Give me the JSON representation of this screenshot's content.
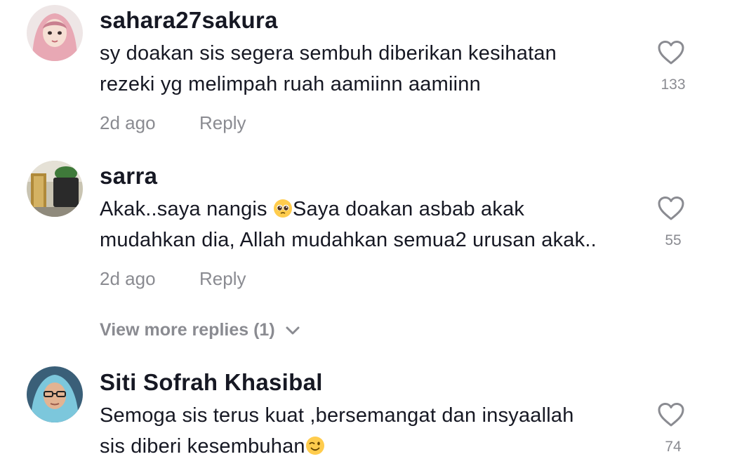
{
  "comments": [
    {
      "username": "sahara27sakura",
      "lines": [
        "sy doakan sis segera sembuh diberikan kesihatan",
        "rezeki yg melimpah ruah aamiinn aamiinn"
      ],
      "time": "2d ago",
      "reply_label": "Reply",
      "likes": "133",
      "avatar_icon": "hijab-girl-avatar"
    },
    {
      "username": "sarra",
      "line1_before_emoji": "Akak..saya nangis ",
      "line1_after_emoji": "Saya doakan asbab akak",
      "line2": "mudahkan dia, Allah mudahkan semua2 urusan akak..",
      "emoji": "pleading-face-emoji",
      "time": "2d ago",
      "reply_label": "Reply",
      "likes": "55",
      "view_more": "View more replies (1)",
      "avatar_icon": "plant-pot-avatar"
    },
    {
      "username": "Siti Sofrah Khasibal",
      "line1": "Semoga sis terus kuat ,bersemangat dan insyaallah",
      "line2_before_emoji": "sis diberi kesembuhan",
      "emoji": "winking-face-emoji",
      "likes": "74",
      "avatar_icon": "woman-glasses-avatar"
    }
  ],
  "colors": {
    "text": "#161823",
    "secondary": "#8a8b91"
  }
}
